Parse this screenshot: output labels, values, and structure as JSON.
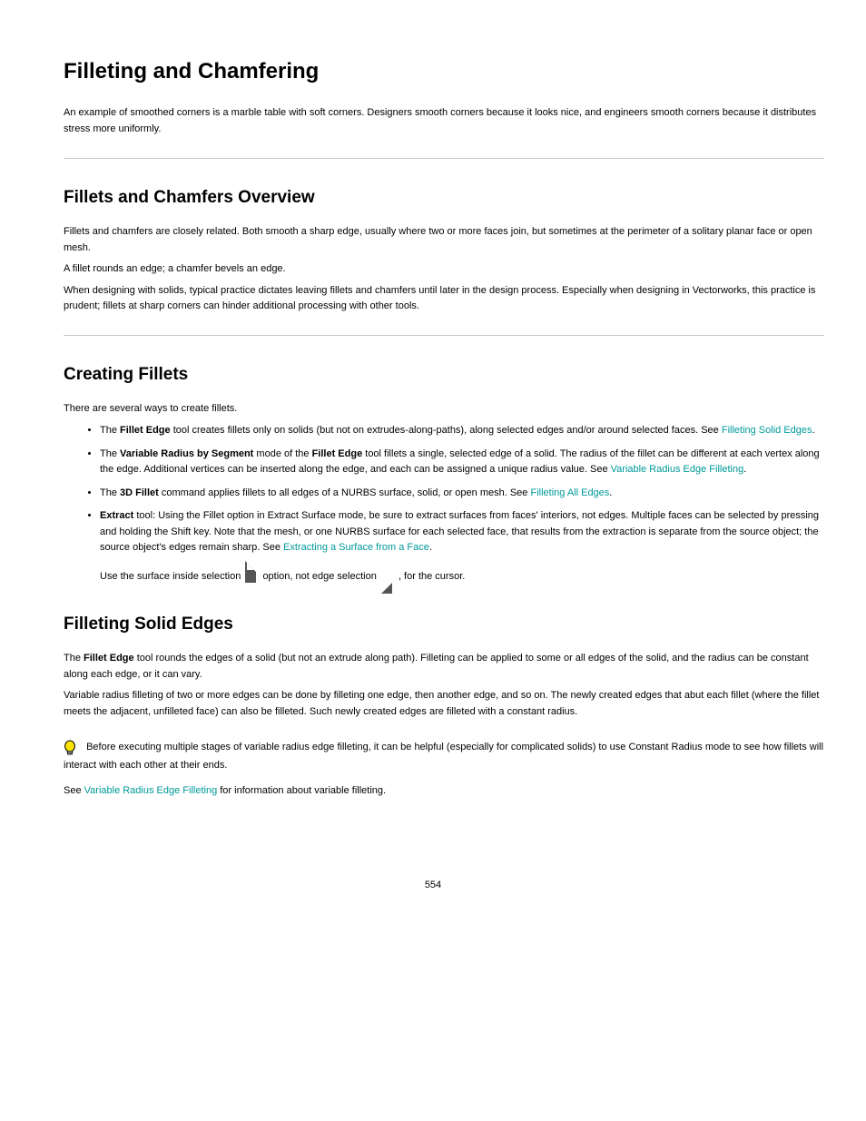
{
  "title": "Filleting and Chamfering",
  "h2_1": "Fillets and Chamfers Overview",
  "h2_2": "Creating Fillets",
  "p_intro": "An example of smoothed corners is a marble table with soft corners. Designers smooth corners because it looks nice, and engineers smooth corners because it distributes stress more uniformly.",
  "p_overview1": "Fillets and chamfers are closely related. Both smooth a sharp edge, usually where two or more faces join, but sometimes at the perimeter of a solitary planar face or open mesh.",
  "p_overview2": "A fillet rounds an edge; a chamfer bevels an edge.",
  "p_overview3": "When designing with solids, typical practice dictates leaving fillets and chamfers until later in the design process. Especially when designing in Vectorworks, this practice is prudent; fillets at sharp corners can hinder additional processing with other tools.",
  "p_create_intro": "There are several ways to create fillets.",
  "bullets": {
    "b1_pre": "The ",
    "b1_bold": "Fillet Edge",
    "b1_post_1": " tool creates fillets only on solids (but not on extrudes-along-paths), along selected edges and/or around selected faces. See ",
    "b1_xref": "Filleting Solid Edges",
    "b1_post_2": ".",
    "b2_pre": "The ",
    "b2_bold": "Variable Radius by Segment",
    "b2_post_1": " mode of the ",
    "b2_bold2": "Fillet Edge",
    "b2_post_2": " tool fillets a single, selected edge of a solid. The radius of the fillet can be different at each vertex along the edge. Additional vertices can be inserted along the edge, and each can be assigned a unique radius value. See ",
    "b2_xref": "Variable Radius Edge Filleting",
    "b2_post_3": ".",
    "b3_pre": "The ",
    "b3_bold": "3D Fillet",
    "b3_post_1": " command applies fillets to all edges of a NURBS surface, solid, or open mesh. See ",
    "b3_xref": "Filleting All Edges",
    "b3_post_2": ".",
    "b4_bold": "Extract",
    "b4_post_1": " tool: Using the Fillet option in Extract Surface mode, be sure to extract surfaces from faces' interiors, not edges. Multiple faces can be selected by pressing and holding the Shift key. Note that the mesh, or one NURBS surface for each selected face, that results from the extraction is separate from the source object; the source object's edges remain sharp. See ",
    "b4_xref": "Extracting a Surface from a Face",
    "b4_post_2": "."
  },
  "icon_sentence_1": "Use the surface inside selection ",
  "icon_sentence_2": " option, not edge selection ",
  "icon_sentence_3": ", for the cursor.",
  "h2_3": "Filleting Solid Edges",
  "p_fillet1_pre": "The ",
  "p_fillet1_bold": "Fillet Edge",
  "p_fillet1_post": " tool rounds the edges of a solid (but not an extrude along path). Filleting can be applied to some or all edges of the solid, and the radius can be constant along each edge, or it can vary.",
  "p_fillet2": "Variable radius filleting of two or more edges can be done by filleting one edge, then another edge, and so on. The newly created edges that abut each fillet (where the fillet meets the adjacent, unfilleted face) can also be filleted. Such newly created edges are filleted with a constant radius.",
  "tip_text": "Before executing multiple stages of variable radius edge filleting, it can be helpful (especially for complicated solids) to use Constant Radius mode to see how fillets will interact with each other at their ends.",
  "sub_pre": "See ",
  "sub_xref": "Variable Radius Edge Filleting",
  "sub_post": " for information about variable filleting.",
  "page_number": "554"
}
